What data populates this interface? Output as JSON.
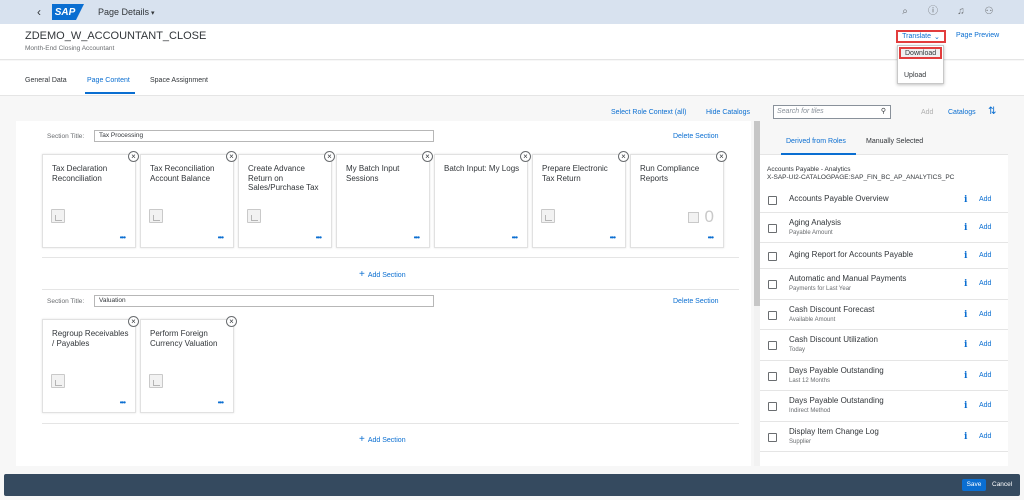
{
  "shell": {
    "back_icon": "chevron-left-icon",
    "logo": "SAP",
    "title": "Page Details",
    "title_caret": "▾",
    "icons": [
      "search-icon",
      "help-icon",
      "bell-icon",
      "user-icon"
    ]
  },
  "header": {
    "title": "ZDEMO_W_ACCOUNTANT_CLOSE",
    "subtitle": "Month-End Closing Accountant",
    "translate_label": "Translate",
    "translate_caret": "⌄",
    "page_preview_label": "Page Preview"
  },
  "translate_menu": {
    "items": [
      "Download",
      "Upload"
    ]
  },
  "tabs": [
    "General Data",
    "Page Content",
    "Space Assignment"
  ],
  "toolbar": {
    "select_role_context": "Select Role Context (all)",
    "hide_catalogs": "Hide Catalogs",
    "search_placeholder": "Search for tiles",
    "add_label": "Add",
    "catalogs_label": "Catalogs"
  },
  "sections": [
    {
      "label": "Section Title:",
      "title": "Tax Processing",
      "delete_label": "Delete Section",
      "tiles": [
        {
          "title": "Tax Declaration Reconciliation",
          "more": "•••"
        },
        {
          "title": "Tax Reconciliation Account Balance",
          "more": "•••"
        },
        {
          "title": "Create Advance Return on Sales/Purchase Tax",
          "more": "•••"
        },
        {
          "title": "My Batch Input Sessions",
          "more": "•••"
        },
        {
          "title": "Batch Input: My Logs",
          "more": "•••"
        },
        {
          "title": "Prepare Electronic Tax Return",
          "more": "•••"
        },
        {
          "title": "Run Compliance Reports",
          "more": "•••",
          "number": "0"
        }
      ],
      "add_section_label": "Add Section"
    },
    {
      "label": "Section Title:",
      "title": "Valuation",
      "delete_label": "Delete Section",
      "tiles": [
        {
          "title": "Regroup Receivables / Payables",
          "more": "•••"
        },
        {
          "title": "Perform Foreign Currency Valuation",
          "more": "•••"
        }
      ],
      "add_section_label": "Add Section"
    }
  ],
  "catalog_panel": {
    "tabs": [
      "Derived from Roles",
      "Manually Selected"
    ],
    "catalog_name": "Accounts Payable - Analytics",
    "catalog_id": "X-SAP-UI2-CATALOGPAGE:SAP_FIN_BC_AP_ANALYTICS_PC",
    "add_label": "Add",
    "info_glyph": "i",
    "apps": [
      {
        "name": "Accounts Payable Overview",
        "sub": ""
      },
      {
        "name": "Aging Analysis",
        "sub": "Payable Amount"
      },
      {
        "name": "Aging Report for Accounts Payable",
        "sub": ""
      },
      {
        "name": "Automatic and Manual Payments",
        "sub": "Payments for Last Year"
      },
      {
        "name": "Cash Discount Forecast",
        "sub": "Available Amount"
      },
      {
        "name": "Cash Discount Utilization",
        "sub": "Today"
      },
      {
        "name": "Days Payable Outstanding",
        "sub": "Last 12 Months"
      },
      {
        "name": "Days Payable Outstanding",
        "sub": "Indirect Method"
      },
      {
        "name": "Display Item Change Log",
        "sub": "Supplier"
      }
    ]
  },
  "footer": {
    "save_label": "Save",
    "cancel_label": "Cancel"
  },
  "colors": {
    "accent": "#0a6ed1",
    "shell": "#d8e2ef",
    "footer": "#354a5f",
    "highlight": "#e23d3d"
  }
}
